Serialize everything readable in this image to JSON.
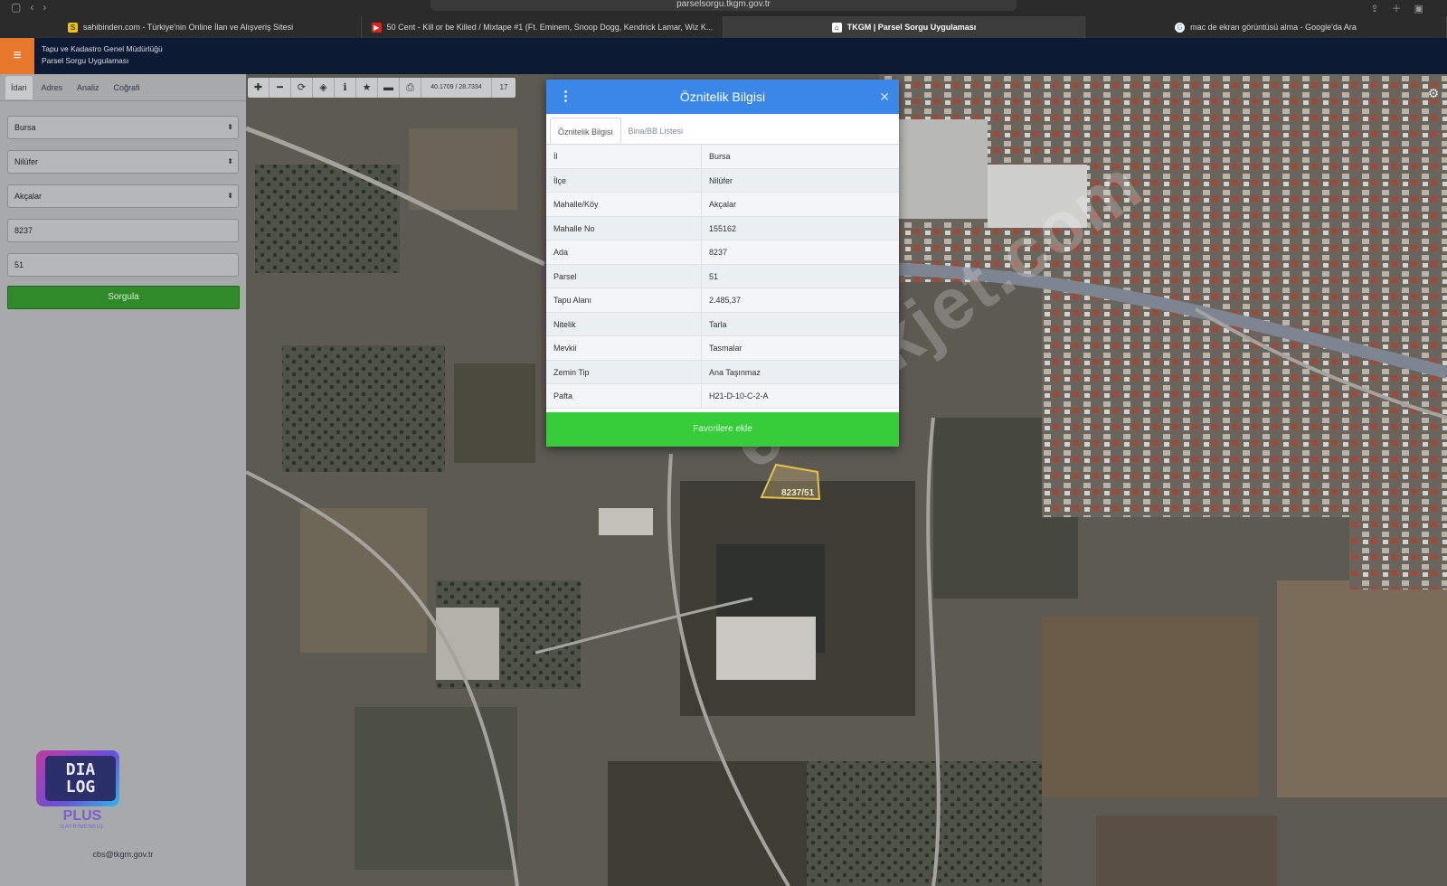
{
  "browser": {
    "url": "parselsorgu.tkgm.gov.tr",
    "tabs": [
      {
        "label": "sahibinden.com - Türkiye'nin Online İlan ve Alışveriş Sitesi",
        "favicon": "S",
        "color": "#f1c400"
      },
      {
        "label": "50 Cent - Kill or be Killed / Mixtape #1 (Ft. Eminem, Snoop Dogg, Kendrick Lamar, Wiz K...",
        "favicon": "▶",
        "color": "#e62117"
      },
      {
        "label": "TKGM | Parsel Sorgu Uygulaması",
        "favicon": "⌂",
        "color": "#ffffff"
      },
      {
        "label": "mac de ekran görüntüsü alma - Google'da Ara",
        "favicon": "G",
        "color": "#ffffff"
      }
    ]
  },
  "header": {
    "org": "Tapu ve Kadastro Genel Müdürlüğü",
    "app": "Parsel Sorgu Uygulaması"
  },
  "left_panel": {
    "tabs": [
      "İdari",
      "Adres",
      "Analiz",
      "Coğrafi"
    ],
    "active_tab": "İdari",
    "il": "Bursa",
    "ilce": "Nilüfer",
    "mahalle": "Akçalar",
    "ada": "8237",
    "parsel": "51",
    "query_button": "Sorgula",
    "footer": "cbs@tkgm.gov.tr",
    "logo": {
      "line1": "DIA",
      "line2": "LOG",
      "plus": "PLUS",
      "sub": "GAYRİMENKUL"
    }
  },
  "map": {
    "coords": "40.1709 / 28.7334",
    "zoom": "17",
    "parcel_label": "8237/51",
    "watermark": "emlakjet.com"
  },
  "popup": {
    "title": "Öznitelik Bilgisi",
    "tabs": [
      "Öznitelik Bilgisi",
      "Bina/BB Listesi"
    ],
    "rows": [
      {
        "key": "İl",
        "value": "Bursa"
      },
      {
        "key": "İlçe",
        "value": "Nilüfer"
      },
      {
        "key": "Mahalle/Köy",
        "value": "Akçalar"
      },
      {
        "key": "Mahalle No",
        "value": "155162"
      },
      {
        "key": "Ada",
        "value": "8237"
      },
      {
        "key": "Parsel",
        "value": "51"
      },
      {
        "key": "Tapu Alanı",
        "value": "2.485,37"
      },
      {
        "key": "Nitelik",
        "value": "Tarla"
      },
      {
        "key": "Mevkii",
        "value": "Tasmalar"
      },
      {
        "key": "Zemin Tip",
        "value": "Ana Taşınmaz"
      },
      {
        "key": "Pafta",
        "value": "H21-D-10-C-2-A"
      }
    ],
    "favorite_button": "Favorilere ekle"
  }
}
